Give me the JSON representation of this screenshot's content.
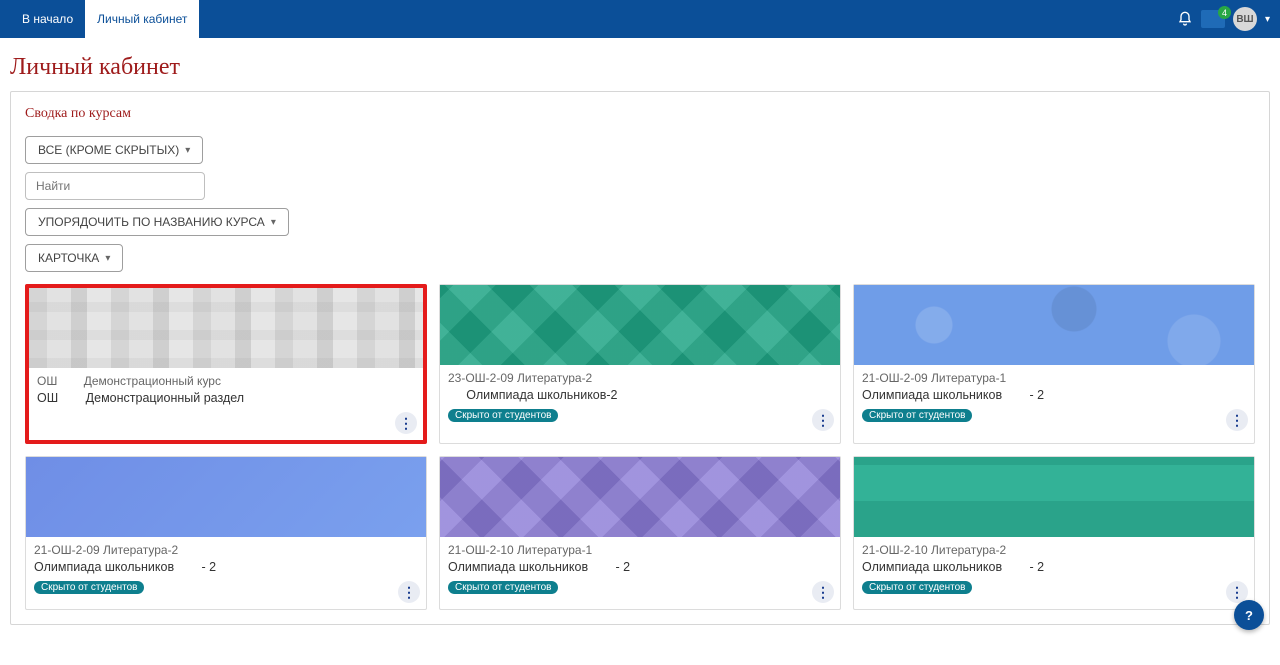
{
  "nav": {
    "home": "В начало",
    "dashboard": "Личный кабинет"
  },
  "header": {
    "msg_badge": "4",
    "user_initials": "ВШ"
  },
  "page_title": "Личный кабинет",
  "overview": {
    "title": "Сводка по курсам",
    "filter_label": "ВСЕ (КРОМЕ СКРЫТЫХ)",
    "search_placeholder": "Найти",
    "sort_label": "УПОРЯДОЧИТЬ ПО НАЗВАНИЮ КУРСА",
    "view_label": "КАРТОЧКА"
  },
  "hidden_label": "Скрыто от студентов",
  "courses": [
    {
      "category": "ОШ⠀⠀⠀Демонстрационный курс",
      "name": "ОШ⠀⠀⠀Демонстрационный раздел",
      "hidden": false,
      "hero": "hero-plaid",
      "highlight": true
    },
    {
      "category": "23-ОШ-2-09 Литература-2",
      "name": "⠀⠀Олимпиада школьников-2",
      "hidden": true,
      "hero": "hero-teal-diamond",
      "highlight": false
    },
    {
      "category": "21-ОШ-2-09 Литература-1",
      "name": "Олимпиада школьников⠀⠀⠀- 2",
      "hidden": true,
      "hero": "hero-blue-circles",
      "highlight": false
    },
    {
      "category": "21-ОШ-2-09 Литература-2",
      "name": "Олимпиада школьников⠀⠀⠀- 2",
      "hidden": true,
      "hero": "hero-blue-flat",
      "highlight": false
    },
    {
      "category": "21-ОШ-2-10 Литература-1",
      "name": "Олимпиада школьников⠀⠀⠀- 2",
      "hidden": true,
      "hero": "hero-purple-diamond",
      "highlight": false
    },
    {
      "category": "21-ОШ-2-10 Литература-2",
      "name": "Олимпиада школьников⠀⠀⠀- 2",
      "hidden": true,
      "hero": "hero-teal-squares",
      "highlight": false
    }
  ],
  "help": "?"
}
